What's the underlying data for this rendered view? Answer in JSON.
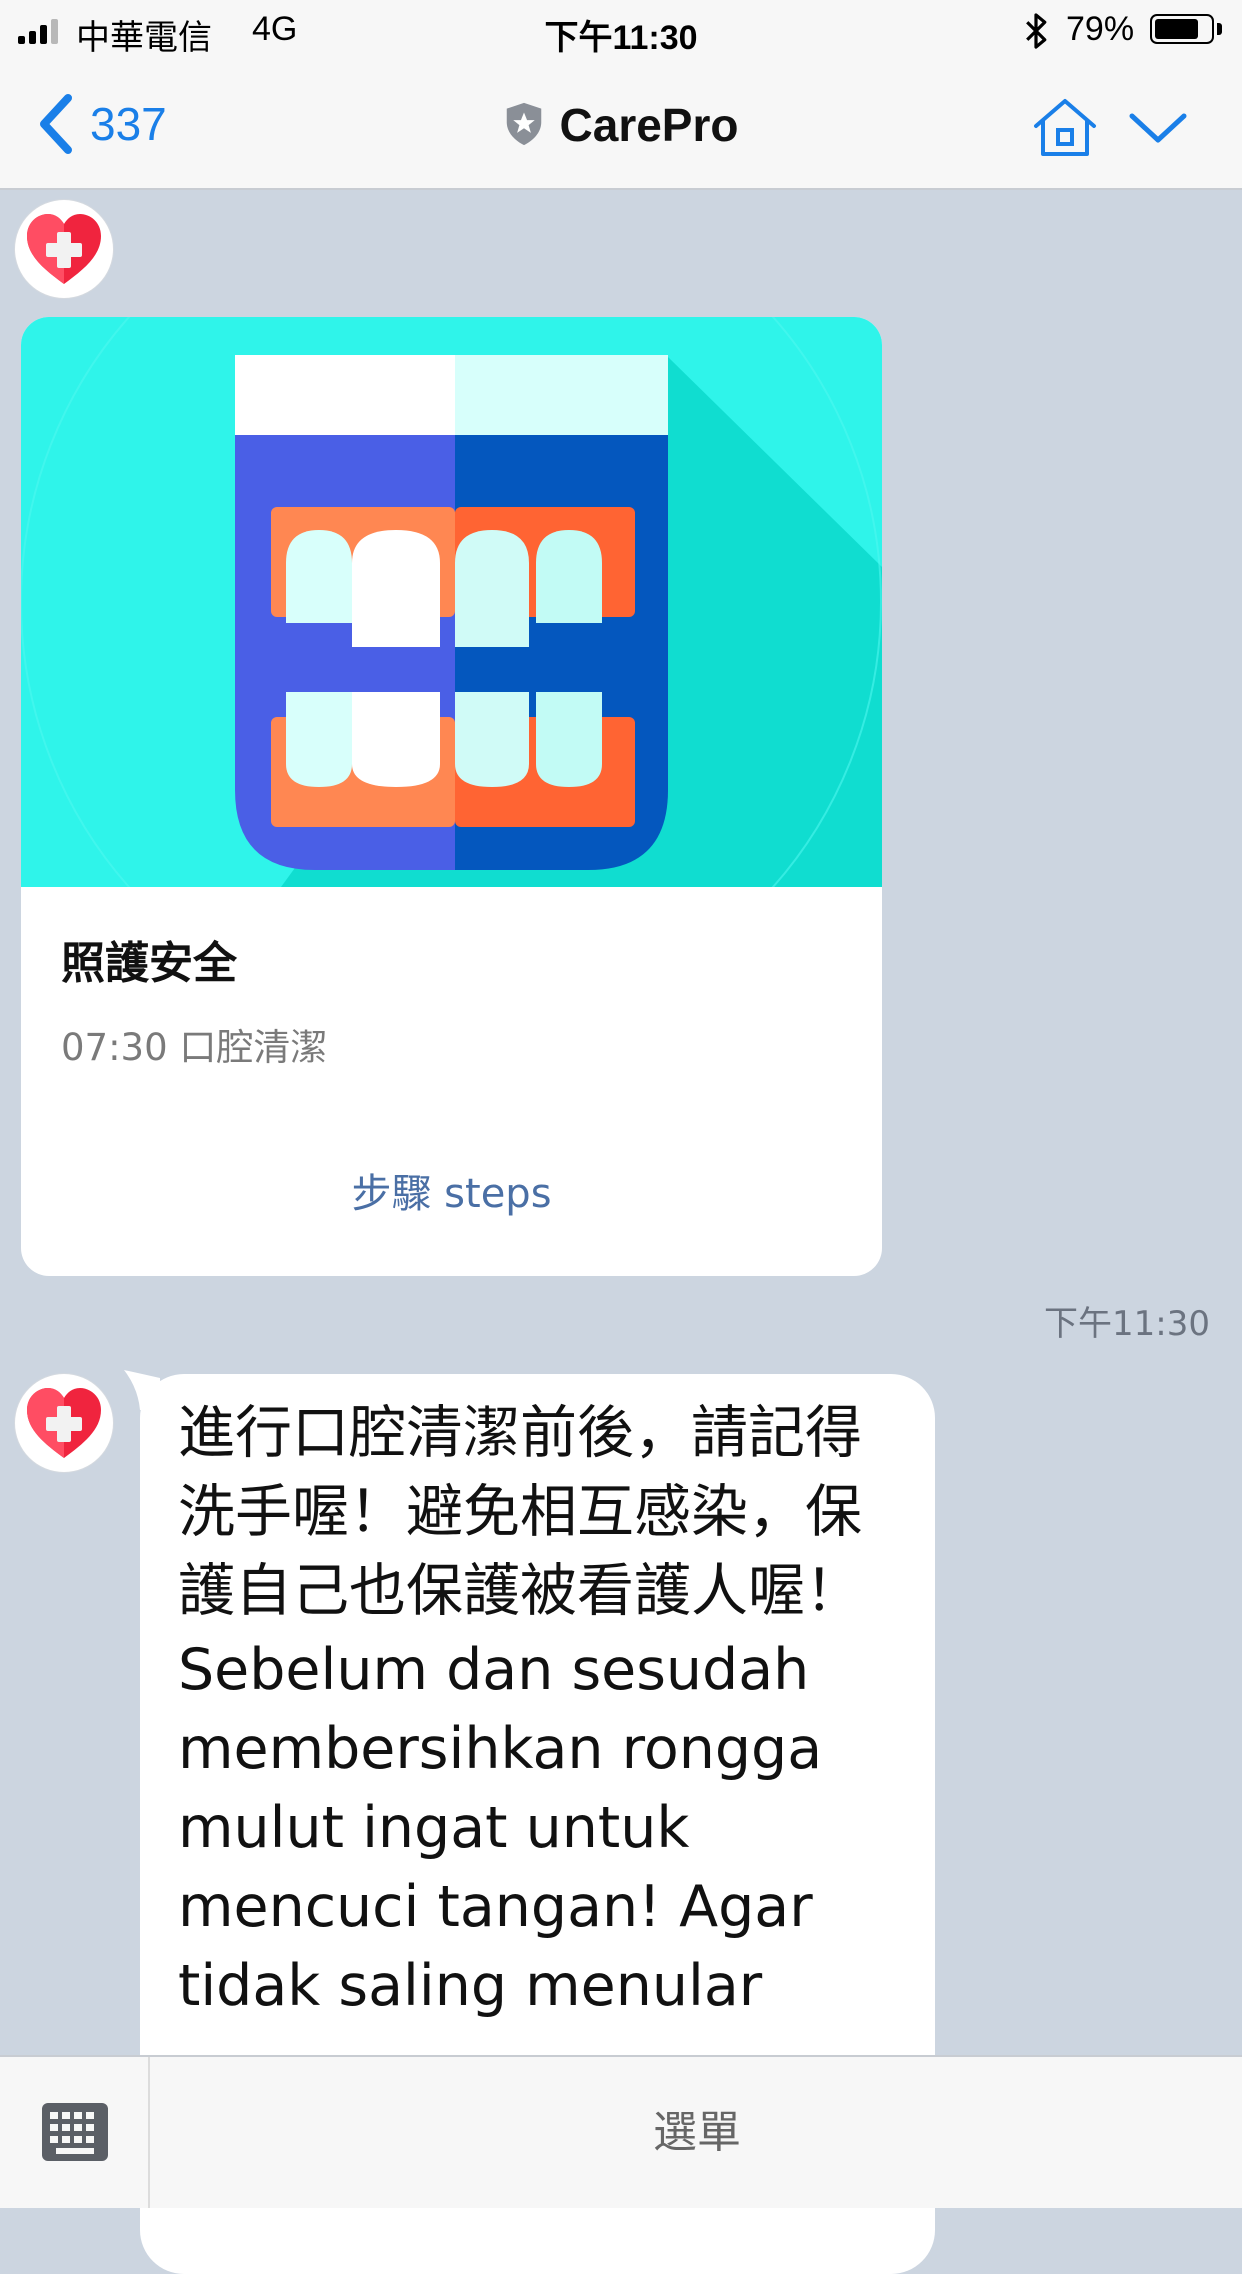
{
  "status_bar": {
    "carrier": "中華電信",
    "network": "4G",
    "time": "下午11:30",
    "battery": "79%",
    "battery_level": 0.79
  },
  "nav": {
    "back_count": "337",
    "title": "CarePro"
  },
  "card": {
    "title": "照護安全",
    "subtitle": "07:30 口腔清潔",
    "action": "步驟 steps"
  },
  "message": {
    "timestamp": "下午11:30",
    "text": "進行口腔清潔前後，請記得洗手喔！避免相互感染，保護自己也保護被看護人喔！Sebelum dan sesudah membersihkan rongga mulut ingat untuk mencuci tangan! Agar tidak saling menular"
  },
  "bottom_bar": {
    "menu_label": "選單"
  },
  "colors": {
    "accent": "#1a7fe8",
    "chat_background": "#ccd5e0",
    "card_image_background": "#2ff4ea"
  },
  "icons": [
    "signal-icon",
    "bluetooth-icon",
    "battery-icon",
    "back-chevron-icon",
    "shield-icon",
    "home-icon",
    "chevron-down-icon",
    "avatar-heart-icon",
    "teeth-illustration",
    "keyboard-icon"
  ]
}
